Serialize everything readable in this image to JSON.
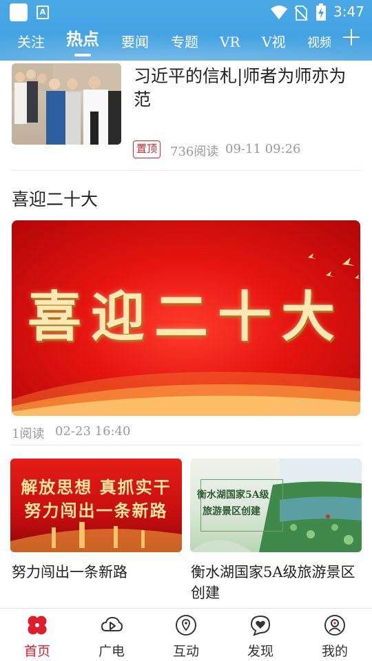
{
  "status_bar": {
    "time": "3:47",
    "notification_icon_label": "A",
    "icons": [
      "app-icon",
      "keyboard-a-icon",
      "wifi-icon",
      "no-sim-icon",
      "battery-charging-icon"
    ]
  },
  "tabs": [
    {
      "label": "关注",
      "active": false
    },
    {
      "label": "热点",
      "active": true
    },
    {
      "label": "要闻",
      "active": false
    },
    {
      "label": "专题",
      "active": false
    },
    {
      "label": "VR",
      "active": false
    },
    {
      "label": "V视",
      "active": false
    },
    {
      "label": "视频",
      "active": false
    }
  ],
  "tab_add_icon": "plus-icon",
  "articles": [
    {
      "title": "习近平的信札|师者为师亦为范",
      "badge": "置顶",
      "reads": "736阅读",
      "time": "09-11 09:26"
    }
  ],
  "section": {
    "title": "喜迎二十大",
    "banner_text": "喜迎二十大",
    "reads": "1阅读",
    "time": "02-23 16:40"
  },
  "cards": [
    {
      "title": "努力闯出一条新路",
      "image_line1": "解放思想 真抓实干",
      "image_line2": "努力闯出一条新路"
    },
    {
      "title": "衡水湖国家5A级旅游景区创建",
      "image_line1": "衡水湖国家5A级",
      "image_line2": "旅游景区创建"
    }
  ],
  "bottom_nav": [
    {
      "label": "首页",
      "icon": "home-clover-icon",
      "active": true
    },
    {
      "label": "广电",
      "icon": "broadcast-play-icon",
      "active": false
    },
    {
      "label": "互动",
      "icon": "location-pin-icon",
      "active": false
    },
    {
      "label": "发现",
      "icon": "discover-heart-icon",
      "active": false
    },
    {
      "label": "我的",
      "icon": "profile-icon",
      "active": false
    }
  ],
  "colors": {
    "header_blue": "#3f9fe0",
    "accent_red": "#e31c2b",
    "meta_gray": "#999999"
  }
}
